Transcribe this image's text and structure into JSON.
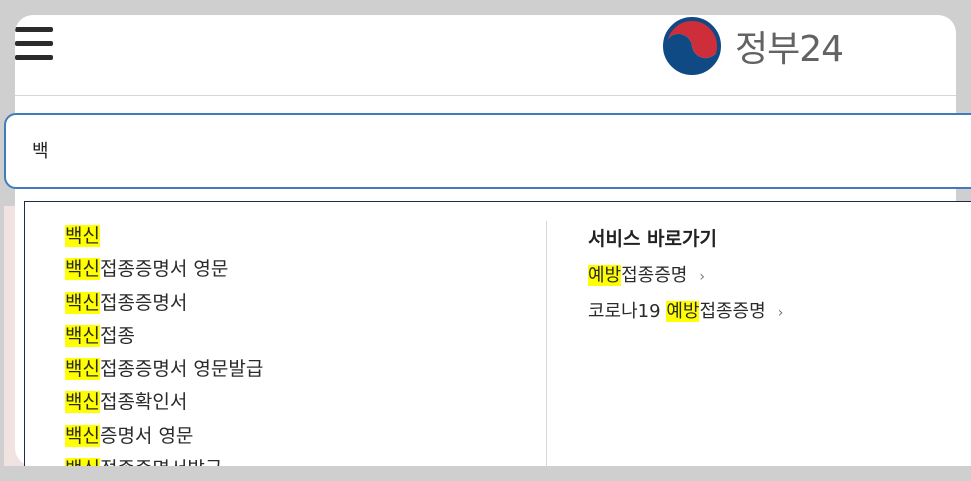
{
  "header": {
    "logo_text": "정부24",
    "menu_icon": "hamburger-menu-icon",
    "emblem_icon": "taegeuk-emblem-icon"
  },
  "search": {
    "value": "백"
  },
  "suggestions": [
    {
      "highlight": "백신",
      "rest": ""
    },
    {
      "highlight": "백신",
      "rest": "접종증명서 영문"
    },
    {
      "highlight": "백신",
      "rest": "접종증명서"
    },
    {
      "highlight": "백신",
      "rest": "접종"
    },
    {
      "highlight": "백신",
      "rest": "접종증명서 영문발급"
    },
    {
      "highlight": "백신",
      "rest": "접종확인서"
    },
    {
      "highlight": "백신",
      "rest": "증명서 영문"
    },
    {
      "highlight": "백신",
      "rest": "접종증명서발급"
    }
  ],
  "services": {
    "title": "서비스 바로가기",
    "items": [
      {
        "prefix": "",
        "highlight": "예방",
        "rest": "접종증명"
      },
      {
        "prefix": "코로나19 ",
        "highlight": "예방",
        "rest": "접종증명"
      }
    ]
  },
  "colors": {
    "highlight": "#ffff00",
    "search_border": "#3f7bc1",
    "dropdown_border": "#1e2b4a",
    "emblem_red": "#cd2e3a",
    "emblem_blue": "#0f4a85"
  }
}
